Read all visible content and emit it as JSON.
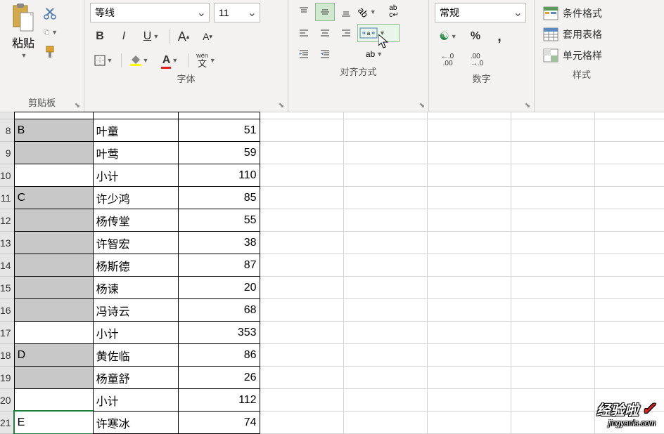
{
  "ribbon": {
    "clipboard": {
      "label": "剪贴板",
      "paste": "粘贴"
    },
    "font": {
      "label": "字体",
      "name": "等线",
      "size": "11",
      "wen": "wén",
      "wenchar": "文"
    },
    "align": {
      "label": "对齐方式",
      "abc": "ab",
      "abc2": "c↵"
    },
    "number": {
      "label": "数字",
      "format": "常规",
      "currency": "💱",
      "percent": "%",
      "comma": ",",
      "inc": ".0",
      "inc2": ".00",
      "dec": ".00",
      "dec2": ".0"
    },
    "styles": {
      "label": "样式",
      "cond": "条件格式",
      "table": "套用表格",
      "cell": "单元格样"
    }
  },
  "rows": [
    {
      "num": "8",
      "a": "B",
      "b": "叶童",
      "c": "51",
      "sel": true
    },
    {
      "num": "9",
      "a": "",
      "b": "叶莺",
      "c": "59",
      "sel": true
    },
    {
      "num": "10",
      "a": "",
      "b": "小计",
      "c": "110",
      "sel": false
    },
    {
      "num": "11",
      "a": "C",
      "b": "许少鸿",
      "c": "85",
      "sel": true
    },
    {
      "num": "12",
      "a": "",
      "b": "杨传堂",
      "c": "55",
      "sel": true
    },
    {
      "num": "13",
      "a": "",
      "b": "许智宏",
      "c": "38",
      "sel": true
    },
    {
      "num": "14",
      "a": "",
      "b": "杨斯德",
      "c": "87",
      "sel": true
    },
    {
      "num": "15",
      "a": "",
      "b": "杨谏",
      "c": "20",
      "sel": true
    },
    {
      "num": "16",
      "a": "",
      "b": "冯诗云",
      "c": "68",
      "sel": true
    },
    {
      "num": "17",
      "a": "",
      "b": "小计",
      "c": "353",
      "sel": false
    },
    {
      "num": "18",
      "a": "D",
      "b": "黄佐临",
      "c": "86",
      "sel": true
    },
    {
      "num": "19",
      "a": "",
      "b": "杨童舒",
      "c": "26",
      "sel": true
    },
    {
      "num": "20",
      "a": "",
      "b": "小计",
      "c": "112",
      "sel": false
    },
    {
      "num": "21",
      "a": "E",
      "b": "许寒冰",
      "c": "74",
      "sel": false,
      "active": true
    }
  ],
  "watermark": {
    "main": "经验啦",
    "sub": "jingyanla.com"
  }
}
